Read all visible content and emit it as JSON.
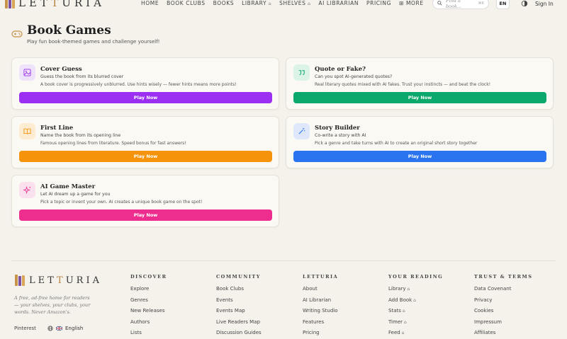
{
  "header": {
    "logo_text_1": "LET",
    "logo_text_2": "T",
    "logo_text_3": "URIA",
    "nav": [
      {
        "label": "HOME",
        "locked": false
      },
      {
        "label": "BOOK CLUBS",
        "locked": false
      },
      {
        "label": "BOOKS",
        "locked": false
      },
      {
        "label": "LIBRARY",
        "locked": true
      },
      {
        "label": "SHELVES",
        "locked": true
      },
      {
        "label": "AI LIBRARIAN",
        "locked": false
      },
      {
        "label": "PRICING",
        "locked": false
      },
      {
        "label": "MORE",
        "locked": false
      }
    ],
    "search_placeholder": "Find a book...",
    "search_shortcut": "⌘K",
    "lang": "EN",
    "signin": "Sign In"
  },
  "page": {
    "title": "Book Games",
    "subtitle": "Play fun book-themed games and challenge yourself!"
  },
  "games": [
    {
      "title": "Cover Guess",
      "subtitle": "Guess the book from its blurred cover",
      "desc": "A book cover is progressively unblurred. Use hints wisely — fewer hints means more points!",
      "button": "Play Now",
      "color": "#9b30f2",
      "icon_bg": "#efe3fb",
      "icon": "image-icon"
    },
    {
      "title": "Quote or Fake?",
      "subtitle": "Can you spot AI-generated quotes?",
      "desc": "Real literary quotes mixed with AI fakes. Trust your instincts — and beat the clock!",
      "button": "Play Now",
      "color": "#0aa86a",
      "icon_bg": "#dcf3e7",
      "icon": "quote-icon"
    },
    {
      "title": "First Line",
      "subtitle": "Name the book from its opening line",
      "desc": "Famous opening lines from literature. Speed bonus for fast answers!",
      "button": "Play Now",
      "color": "#f5940b",
      "icon_bg": "#fdecd2",
      "icon": "book-open-icon"
    },
    {
      "title": "Story Builder",
      "subtitle": "Co-write a story with AI",
      "desc": "Pick a genre and take turns with AI to create an original short story together",
      "button": "Play Now",
      "color": "#2a74f0",
      "icon_bg": "#dfe8fb",
      "icon": "wand-icon"
    },
    {
      "title": "AI Game Master",
      "subtitle": "Let AI dream up a game for you",
      "desc": "Pick a topic or invent your own. AI creates a unique book game on the spot!",
      "button": "Play Now",
      "color": "#ee2e8e",
      "icon_bg": "#fbe1ee",
      "icon": "sparkles-icon"
    }
  ],
  "footer": {
    "tagline": "A free, ad-free home for readers — your shelves, your clubs, your words. Never Amazon's.",
    "pinterest": "Pinterest",
    "lang": "English",
    "columns": [
      {
        "heading": "DISCOVER",
        "links": [
          {
            "label": "Explore",
            "locked": false
          },
          {
            "label": "Genres",
            "locked": false
          },
          {
            "label": "New Releases",
            "locked": false
          },
          {
            "label": "Authors",
            "locked": false
          },
          {
            "label": "Lists",
            "locked": false
          }
        ]
      },
      {
        "heading": "COMMUNITY",
        "links": [
          {
            "label": "Book Clubs",
            "locked": false
          },
          {
            "label": "Events",
            "locked": false
          },
          {
            "label": "Events Map",
            "locked": false
          },
          {
            "label": "Live Readers Map",
            "locked": false
          },
          {
            "label": "Discussion Guides",
            "locked": false
          }
        ]
      },
      {
        "heading": "LETTURIA",
        "links": [
          {
            "label": "About",
            "locked": false
          },
          {
            "label": "AI Librarian",
            "locked": false
          },
          {
            "label": "Writing Studio",
            "locked": false
          },
          {
            "label": "Features",
            "locked": false
          },
          {
            "label": "Pricing",
            "locked": false
          }
        ]
      },
      {
        "heading": "YOUR READING",
        "links": [
          {
            "label": "Library",
            "locked": true
          },
          {
            "label": "Add Book",
            "locked": true
          },
          {
            "label": "Stats",
            "locked": true
          },
          {
            "label": "Timer",
            "locked": true
          },
          {
            "label": "Feed",
            "locked": true
          }
        ]
      },
      {
        "heading": "TRUST & TERMS",
        "links": [
          {
            "label": "Data Covenant",
            "locked": false
          },
          {
            "label": "Privacy",
            "locked": false
          },
          {
            "label": "Cookies",
            "locked": false
          },
          {
            "label": "Impressum",
            "locked": false
          },
          {
            "label": "Affiliates",
            "locked": false
          }
        ]
      }
    ]
  }
}
